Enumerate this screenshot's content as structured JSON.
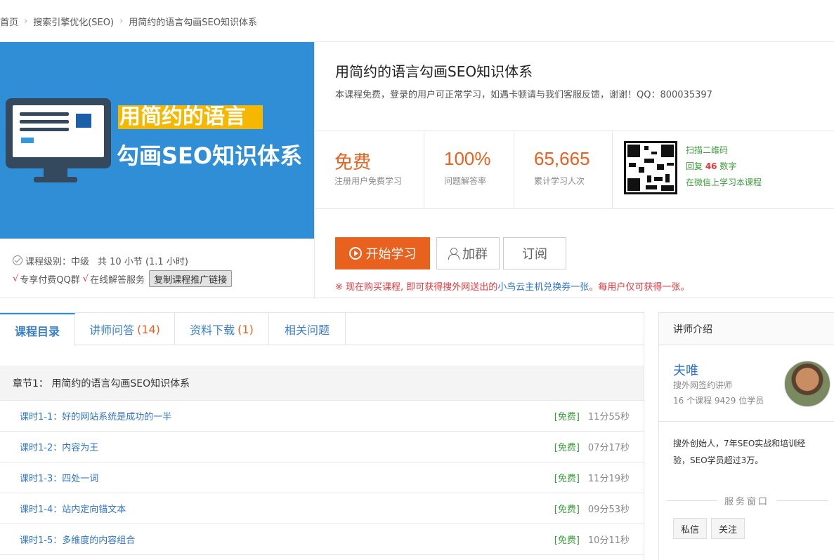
{
  "breadcrumb": [
    "首页",
    "搜索引擎优化(SEO)",
    "用简约的语言勾画SEO知识体系"
  ],
  "cover": {
    "line1": "用简约的语言",
    "line2": "勾画SEO知识体系"
  },
  "meta": {
    "level": "课程级别：中级",
    "count": "共 10 小节 (1.1 小时)",
    "tick": "√",
    "perk1": "专享付费QQ群",
    "perk2": "在线解答服务",
    "copy_btn": "复制课程推广链接"
  },
  "course": {
    "title": "用简约的语言勾画SEO知识体系",
    "desc": "本课程免费，登录的用户可正常学习，如遇卡顿请与我们客服反馈，谢谢！QQ：800035397"
  },
  "stats": [
    {
      "big": "免费",
      "small": "注册用户免费学习"
    },
    {
      "big": "100%",
      "small": "问题解答率"
    },
    {
      "big": "65,665",
      "small": "累计学习人次"
    }
  ],
  "qr": {
    "line1": "扫描二维码",
    "line2a": "回复 ",
    "line2b": "46",
    "line2c": " 数字",
    "line3": "在微信上学习本课程"
  },
  "actions": {
    "start": "开始学习",
    "group": "加群",
    "subscribe": "订阅"
  },
  "promo": {
    "a": "※ 现在购买课程, 即可获得搜外网送出的",
    "b": "小鸟云主机兑换券一张",
    "c": "。每用户仅可获得一张。"
  },
  "tabs": [
    {
      "label": "课程目录",
      "count": ""
    },
    {
      "label": "讲师问答",
      "count": "(14)"
    },
    {
      "label": "资料下载",
      "count": "(1)"
    },
    {
      "label": "相关问题",
      "count": ""
    }
  ],
  "chapter": "章节1： 用简约的语言勾画SEO知识体系",
  "lessons": [
    {
      "title": "课时1-1：好的网站系统是成功的一半",
      "tag": "[免费]",
      "dur": "11分55秒"
    },
    {
      "title": "课时1-2：内容为王",
      "tag": "[免费]",
      "dur": "07分17秒"
    },
    {
      "title": "课时1-3：四处一词",
      "tag": "[免费]",
      "dur": "11分19秒"
    },
    {
      "title": "课时1-4：站内定向锚文本",
      "tag": "[免费]",
      "dur": "09分53秒"
    },
    {
      "title": "课时1-5：多维度的内容组合",
      "tag": "[免费]",
      "dur": "10分11秒"
    }
  ],
  "teacher": {
    "header": "讲师介绍",
    "name": "夫唯",
    "role": "搜外网签约讲师",
    "info": "16 个课程 9429 位学员",
    "bio": "搜外创始人，7年SEO实战和培训经验，SEO学员超过3万。",
    "service": "服务窗口",
    "btn_msg": "私信",
    "btn_follow": "关注"
  },
  "colors": {
    "accent": "#e8611e",
    "cover_bg": "#2f8ed6",
    "link": "#2f74c8",
    "free": "#3a9d3a"
  }
}
